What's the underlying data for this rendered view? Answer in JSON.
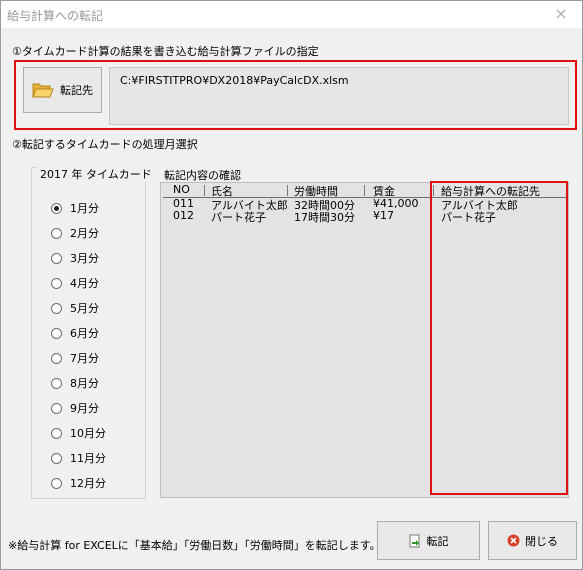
{
  "window": {
    "title": "給与計算への転記",
    "close_glyph": "×"
  },
  "section1": {
    "label": "①タイムカード計算の結果を書き込む給与計算ファイルの指定",
    "button_label": "転記先",
    "file_path": "C:¥FIRSTITPRO¥DX2018¥PayCalcDX.xlsm"
  },
  "section2": {
    "label": "②転記するタイムカードの処理月選択",
    "group_title": "2017 年 タイムカード",
    "months": [
      "1月分",
      "2月分",
      "3月分",
      "4月分",
      "5月分",
      "6月分",
      "7月分",
      "8月分",
      "9月分",
      "10月分",
      "11月分",
      "12月分"
    ],
    "selected_month": "1月分"
  },
  "table": {
    "caption": "転記内容の確認",
    "headers": [
      "NO",
      "氏名",
      "労働時間",
      "賃金",
      "給与計算への転記先"
    ],
    "rows": [
      [
        "011",
        "アルバイト太郎",
        "32時間00分",
        "¥41,000",
        "アルバイト太郎"
      ],
      [
        "012",
        "パート花子",
        "17時間30分",
        "¥17",
        "パート花子"
      ]
    ]
  },
  "footer": {
    "note": "※給与計算 for EXCELに「基本給」「労働日数」「労働時間」を転記します。",
    "transfer_label": "転記",
    "close_label": "閉じる"
  },
  "colors": {
    "highlight_border": "#e01010",
    "window_bg": "#f0f0f0",
    "list_bg": "#e3e3e3"
  }
}
